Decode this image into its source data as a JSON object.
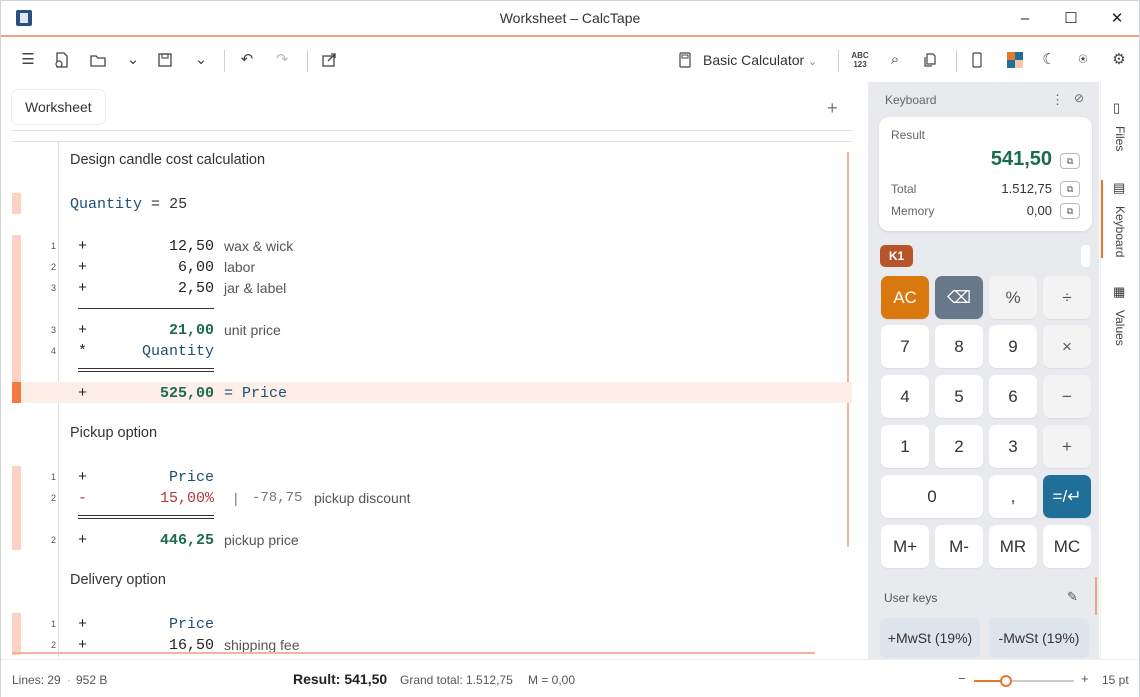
{
  "window": {
    "title": "Worksheet",
    "app": "CalcTape",
    "title_full": "Worksheet  –  CalcTape"
  },
  "toolbar": {
    "calculator": "Basic Calculator",
    "abc": "ABC\n123"
  },
  "tabs": [
    {
      "label": "Worksheet"
    }
  ],
  "sheet": {
    "title": "Design candle cost calculation",
    "quantity_name": "Quantity",
    "quantity_eq": "=",
    "quantity_value": "25",
    "l1": {
      "ln": "1",
      "op": "+",
      "num": "12,50",
      "com": "wax & wick"
    },
    "l2": {
      "ln": "2",
      "op": "+",
      "num": "6,00",
      "com": "labor"
    },
    "l3": {
      "ln": "3",
      "op": "+",
      "num": "2,50",
      "com": "jar & label"
    },
    "l4": {
      "ln": "3",
      "op": "+",
      "num": "21,00",
      "com": "unit price"
    },
    "l5": {
      "ln": "4",
      "op": "*",
      "num": "Quantity"
    },
    "l6": {
      "op": "+",
      "num": "525,00",
      "com": "= Price"
    },
    "pickup": "Pickup option",
    "p1": {
      "ln": "1",
      "op": "+",
      "num": "Price"
    },
    "p2": {
      "ln": "2",
      "op": "-",
      "num": "15,00%",
      "sep": "|",
      "extra": "-78,75",
      "com": "pickup discount"
    },
    "p3": {
      "ln": "2",
      "op": "+",
      "num": "446,25",
      "com": "pickup price"
    },
    "delivery": "Delivery option",
    "d1": {
      "ln": "1",
      "op": "+",
      "num": "Price"
    },
    "d2": {
      "ln": "2",
      "op": "+",
      "num": "16,50",
      "com": "shipping fee"
    }
  },
  "panel": {
    "header": "Keyboard",
    "result_label": "Result",
    "result_value": "541,50",
    "total_label": "Total",
    "total_value": "1.512,75",
    "memory_label": "Memory",
    "memory_value": "0,00",
    "k1": "K1",
    "keys": [
      "AC",
      "⌫",
      "%",
      "÷",
      "7",
      "8",
      "9",
      "×",
      "4",
      "5",
      "6",
      "−",
      "1",
      "2",
      "3",
      "+",
      "0",
      ",",
      "=/↵",
      "M+",
      "M-",
      "MR",
      "MC"
    ],
    "user_keys_label": "User keys",
    "user_keys": [
      "+MwSt (19%)",
      "-MwSt (19%)"
    ]
  },
  "side": {
    "files": "Files",
    "keyboard": "Keyboard",
    "values": "Values"
  },
  "status": {
    "lines": "Lines: 29",
    "size": "952 B",
    "result": "Result: 541,50",
    "grand": "Grand total: 1.512,75",
    "memory": "M = 0,00",
    "zoom": "15 pt",
    "minus": "−",
    "plus": "+"
  }
}
